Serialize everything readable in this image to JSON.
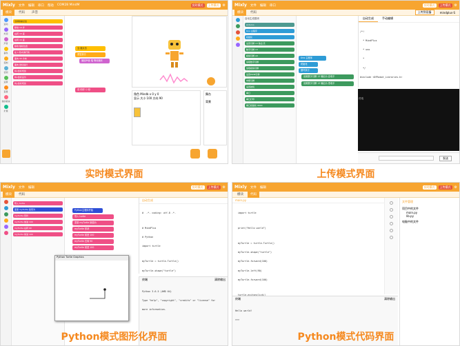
{
  "panels": [
    {
      "app_title": "Mixly",
      "menu": [
        "文件",
        "编辑",
        "串口",
        "帮助",
        "COM28 MindM"
      ],
      "modes": [
        "实时模式",
        "上传模式"
      ],
      "tabs": [
        "模块",
        "代码",
        "声音"
      ],
      "categories": [
        "运动",
        "外观",
        "声音",
        "事件",
        "控制",
        "侦测",
        "运算",
        "变量",
        "我的模块",
        "扩展"
      ],
      "blocks": [
        "当绿旗被点击",
        "移动 10 步",
        "右转 15 度",
        "左转 15 度",
        "移到 随机位置",
        "在 1 秒内滑行到",
        "面向 90 方向",
        "面向 鼠标指针",
        "将x坐标增加",
        "将x坐标设为",
        "将y坐标增加"
      ],
      "ws_blocks": [
        "当 被点击",
        "重复执行",
        "播放声音 喵 等待播完",
        "说 你好! 2 秒"
      ],
      "sprite_label": "角色",
      "sprite_name": "Mindb",
      "sprite_xy": [
        "x 0",
        "y 0"
      ],
      "show_label": "显示",
      "size_label": "大小 100",
      "dir_label": "方向 90",
      "stage_label": "舞台",
      "backdrop_label": "背景",
      "caption": "实时模式界面"
    },
    {
      "app_title": "Mixly",
      "menu": [
        "文件",
        "编辑",
        "串口"
      ],
      "tabs": [
        "模块",
        "代码"
      ],
      "upload_label": "上传到设备",
      "board": "mindplus-S",
      "code_tabs": [
        "自动生成",
        "手动编辑"
      ],
      "palette_header": "自动生成模块",
      "palette_blocks": [
        "Arduino",
        "Uno 主程序",
        "初始化",
        "设置引脚 13 输出 高",
        "数字引脚 13",
        "模拟引脚 A0",
        "读取数字引脚",
        "读取模拟引脚",
        "设置PWM引脚",
        "中断引脚",
        "设置舵机",
        "串口",
        "串口打印",
        "串口初始化 9600"
      ],
      "ws_blocks": [
        "Uno 主程序",
        "初始化",
        "循环执行",
        "设置数字引脚 13 输出为 高电平",
        "设置数字引脚 13 输出为 低电平"
      ],
      "code_lines": [
        "/*!",
        "  * MindPlus",
        "  * uno",
        "  *",
        "  */",
        "#include <DFRobot_Libraries.h>",
        "",
        "void setup() {",
        "  pinMode(13, OUTPUT);",
        "}",
        "void loop() {",
        "  digitalWrite(13, HIGH);",
        "  delay(1000);",
        "  digitalWrite(13, LOW);",
        "  delay(1000);",
        "}"
      ],
      "terminal_label": "终端",
      "send_label": "发送",
      "caption": "上传模式界面"
    },
    {
      "app_title": "Mixly",
      "menu": [
        "文件",
        "编辑"
      ],
      "tabs": [
        "模块",
        "代码"
      ],
      "code_header": "自动生成",
      "ws_header": "Python主程序开始",
      "ws_blocks": [
        "Python主程序开始",
        "导入 turtle",
        "变量 myTurtle 赋值为",
        "myTurtle 形状",
        "myTurtle 前进 100",
        "myTurtle 右转 90",
        "myTurtle 前进 100",
        "myTurtle 左转 90",
        "完成绘图"
      ],
      "window_title": "Python Turtle Graphics",
      "code_lines": [
        "#  -*- coding: utf-8 -*-",
        "",
        "# MindPlus",
        "# Python",
        "import turtle",
        "",
        "myTurtle = turtle.Turtle()",
        "myTurtle.shape(\"turtle\")",
        "myTurtle.forward(100)",
        "myTurtle.left(90)",
        "myTurtle.forward(100)",
        "turtle.exitonclick()"
      ],
      "terminal_label": "终端",
      "clear_label": "清除输出",
      "terminal_lines": [
        "Python 3.6.5 (AMD 64)",
        "Type \"help\", \"copyright\", \"credits\" or \"license\" for",
        "more information."
      ],
      "caption": "Python模式图形化界面"
    },
    {
      "app_title": "Mixly",
      "menu": [
        "文件",
        "编辑"
      ],
      "tabs": [
        "模块",
        "代码"
      ],
      "file_tab": "main.py",
      "code_lines": [
        "import turtle",
        "",
        "print(\"Hello world\")",
        "",
        "myTurtle = turtle.Turtle()",
        "myTurtle.shape(\"turtle\")",
        "myTurtle.forward(100)",
        "myTurtle.left(90)",
        "myTurtle.forward(100)",
        "",
        "turtle.exitonclick()"
      ],
      "files_header": "文件管理",
      "files": [
        "项目中的文件",
        "main.py",
        "lib.py",
        "电脑中的文件"
      ],
      "terminal_label": "终端",
      "clear_label": "清除输出",
      "terminal_lines": [
        "Hello world!",
        ">>>"
      ],
      "caption": "Python模式代码界面"
    }
  ],
  "colors": {
    "brand": "#f7a530",
    "caption": "#f5891f",
    "motion": "#4c97ff",
    "looks": "#9966ff",
    "sound": "#cf63cf",
    "control": "#ffab19",
    "pink": "#ef4f86",
    "blue": "#2e9cd6",
    "green": "#3d9a5e",
    "teal": "#4e9a91"
  }
}
